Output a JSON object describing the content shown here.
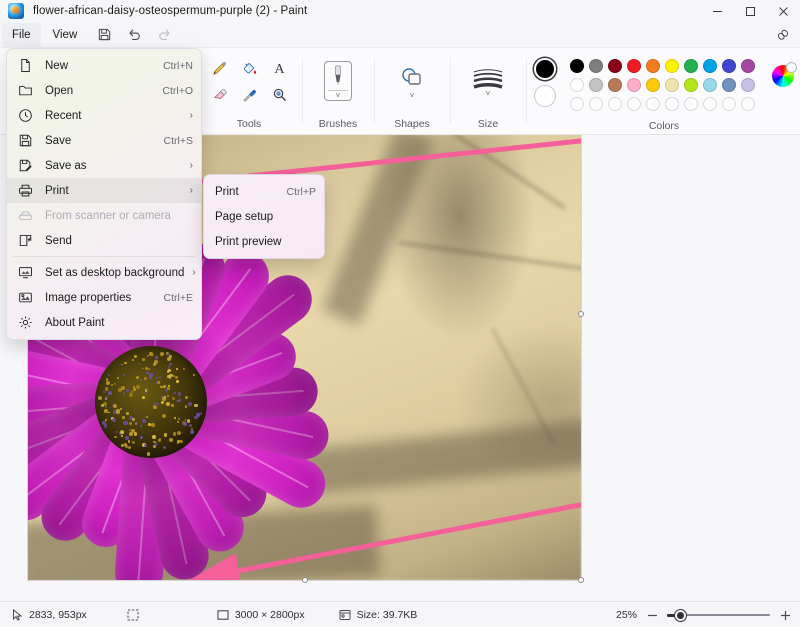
{
  "window": {
    "title": "flower-african-daisy-osteospermum-purple (2) - Paint",
    "app_icon": "paint-app-icon",
    "controls": {
      "minimize": "minimize-icon",
      "maximize": "maximize-icon",
      "close": "close-icon"
    }
  },
  "menubar": {
    "items": [
      {
        "label": "File",
        "active": true
      },
      {
        "label": "View",
        "active": false
      }
    ],
    "commands": [
      {
        "name": "save-icon",
        "disabled": false
      },
      {
        "name": "undo-icon",
        "disabled": false
      },
      {
        "name": "redo-icon",
        "disabled": true
      }
    ],
    "link_icon": "link-icon"
  },
  "ribbon": {
    "groups": [
      {
        "label": "Tools",
        "name": "tools-group"
      },
      {
        "label": "Brushes",
        "name": "brushes-group"
      },
      {
        "label": "Shapes",
        "name": "shapes-group"
      },
      {
        "label": "Size",
        "name": "size-group"
      },
      {
        "label": "Colors",
        "name": "colors-group"
      }
    ],
    "tools": [
      "pencil-icon",
      "fill-bucket-icon",
      "text-icon",
      "eraser-icon",
      "eyedropper-icon",
      "magnifier-icon"
    ],
    "colors": {
      "primary": "#000000",
      "secondary": "#ffffff",
      "row1": [
        "#000000",
        "#7f7f7f",
        "#8b0014",
        "#ed1c24",
        "#f07d22",
        "#fff200",
        "#22b14c",
        "#00a2e8",
        "#3f48cc",
        "#a349a4"
      ],
      "row2": [
        "#ffffff",
        "#c3c3c3",
        "#b97a57",
        "#ffaec9",
        "#ffc90e",
        "#efe4b0",
        "#b5e61d",
        "#99d9ea",
        "#7092be",
        "#c8bfe7"
      ],
      "row3": [
        "",
        "",
        "",
        "",
        "",
        "",
        "",
        "",
        "",
        ""
      ],
      "wheel": "color-wheel-icon"
    }
  },
  "file_menu": {
    "items": [
      {
        "label": "New",
        "accel": "Ctrl+N",
        "icon": "new-document-icon",
        "submenu": false,
        "disabled": false,
        "highlighted": false
      },
      {
        "label": "Open",
        "accel": "Ctrl+O",
        "icon": "open-folder-icon",
        "submenu": false,
        "disabled": false,
        "highlighted": false
      },
      {
        "label": "Recent",
        "accel": "",
        "icon": "clock-icon",
        "submenu": true,
        "disabled": false,
        "highlighted": false
      },
      {
        "label": "Save",
        "accel": "Ctrl+S",
        "icon": "save-icon",
        "submenu": false,
        "disabled": false,
        "highlighted": false
      },
      {
        "label": "Save as",
        "accel": "",
        "icon": "save-as-icon",
        "submenu": true,
        "disabled": false,
        "highlighted": false
      },
      {
        "label": "Print",
        "accel": "",
        "icon": "printer-icon",
        "submenu": true,
        "disabled": false,
        "highlighted": true
      },
      {
        "label": "From scanner or camera",
        "accel": "",
        "icon": "scanner-icon",
        "submenu": false,
        "disabled": true,
        "highlighted": false
      },
      {
        "label": "Send",
        "accel": "",
        "icon": "send-icon",
        "submenu": false,
        "disabled": false,
        "highlighted": false
      },
      {
        "label": "Set as desktop background",
        "accel": "",
        "icon": "desktop-background-icon",
        "submenu": true,
        "disabled": false,
        "highlighted": false
      },
      {
        "label": "Image properties",
        "accel": "Ctrl+E",
        "icon": "image-properties-icon",
        "submenu": false,
        "disabled": false,
        "highlighted": false
      },
      {
        "label": "About Paint",
        "accel": "",
        "icon": "gear-icon",
        "submenu": false,
        "disabled": false,
        "highlighted": false
      }
    ]
  },
  "print_submenu": {
    "items": [
      {
        "label": "Print",
        "accel": "Ctrl+P"
      },
      {
        "label": "Page setup",
        "accel": ""
      },
      {
        "label": "Print preview",
        "accel": ""
      }
    ]
  },
  "statusbar": {
    "cursor_position": "2833, 953px",
    "cursor_icon": "cursor-icon",
    "selection_icon": "selection-size-icon",
    "canvas_icon": "canvas-size-icon",
    "canvas_size": "3000 × 2800px",
    "file_size_icon": "file-size-icon",
    "file_size": "Size: 39.7KB",
    "zoom_level": "25%",
    "zoom_out_icon": "minus-icon",
    "zoom_in_icon": "plus-icon"
  },
  "annotations": {
    "arrow_color": "#f5609a",
    "arrow_top": "arrow-pointing-to-print-menu",
    "arrow_bottom": "arrow-pointing-to-canvas-bottom"
  }
}
